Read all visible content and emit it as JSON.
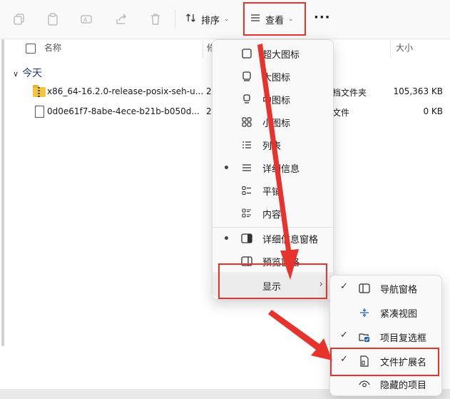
{
  "toolbar": {
    "sort_label": "排序",
    "view_label": "查看",
    "more_label": "···",
    "icons": [
      "copy-icon",
      "paste-icon",
      "rename-icon",
      "share-icon",
      "delete-icon"
    ]
  },
  "columns": {
    "name": "名称",
    "date_partial": "修",
    "size": "大小"
  },
  "group": {
    "label": "今天"
  },
  "files": [
    {
      "name": "x86_64-16.2.0-release-posix-seh-u...",
      "date_partial": "2",
      "type_partial": "档文件夹",
      "size": "105,363 KB"
    },
    {
      "name": "0d0e61f7-8abe-4ece-b21b-b050d...",
      "date_partial": "2",
      "type_partial": "文件",
      "size": "0 KB"
    }
  ],
  "view_menu": {
    "items": [
      {
        "label": "超大图标",
        "icon": "extra-large-icons-icon",
        "dot": false
      },
      {
        "label": "大图标",
        "icon": "large-icons-icon",
        "dot": false
      },
      {
        "label": "中图标",
        "icon": "medium-icons-icon",
        "dot": false
      },
      {
        "label": "小图标",
        "icon": "small-icons-icon",
        "dot": false
      },
      {
        "label": "列表",
        "icon": "list-view-icon",
        "dot": false
      },
      {
        "label": "详细信息",
        "icon": "details-view-icon",
        "dot": true
      },
      {
        "label": "平铺",
        "icon": "tiles-view-icon",
        "dot": false
      },
      {
        "label": "内容",
        "icon": "content-view-icon",
        "dot": false
      }
    ],
    "pane_items": [
      {
        "label": "详细信息窗格",
        "icon": "details-pane-icon",
        "dot": true
      },
      {
        "label": "预览窗格",
        "icon": "preview-pane-icon",
        "dot": false
      }
    ],
    "show_label": "显示"
  },
  "show_submenu": {
    "items": [
      {
        "label": "导航窗格",
        "icon": "navigation-pane-icon",
        "checked": true
      },
      {
        "label": "紧凑视图",
        "icon": "compact-view-icon",
        "checked": false
      },
      {
        "label": "项目复选框",
        "icon": "item-checkbox-icon",
        "checked": true
      },
      {
        "label": "文件扩展名",
        "icon": "file-extension-icon",
        "checked": true
      },
      {
        "label": "隐藏的项目",
        "icon": "hidden-items-icon",
        "checked": false
      }
    ]
  },
  "colors": {
    "annotation": "#e8332d",
    "accent": "#1f5fbf"
  }
}
